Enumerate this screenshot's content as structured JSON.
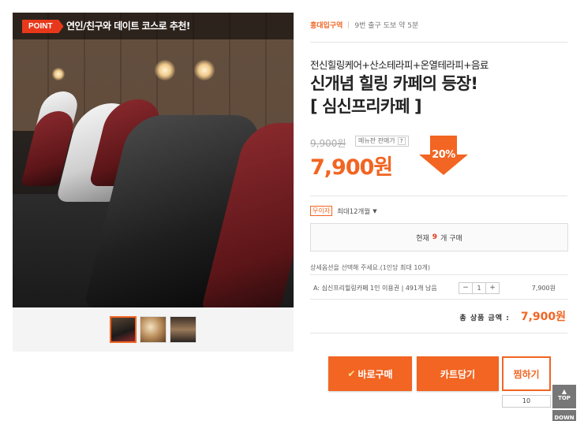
{
  "gallery": {
    "banner": {
      "badge": "POINT",
      "text": "연인/친구와 데이트 코스로 추천!"
    },
    "thumbnails": [
      "main-photo",
      "interior-photo",
      "cafe-photo"
    ]
  },
  "product": {
    "location_area": "홍대입구역",
    "location_detail": "9번 출구 도보 약 5분",
    "subtitle": "전신힐링케어+산소테라피+온열테라피+음료",
    "title_line1": "신개념 힐링 카페의 등장!",
    "title_line2": "[ 심신프리카페 ]",
    "original_price": "9,900원",
    "fixed_price_label": "메뉴판 판매가",
    "help": "?",
    "sale_price": "7,900원",
    "discount": "20%"
  },
  "installment": {
    "free_tag": "무이자",
    "label": "최대12개월",
    "caret": "▼"
  },
  "purchase_status": {
    "prefix": "현재",
    "count": "9",
    "suffix": "개 구매"
  },
  "options": {
    "guide": "상세옵션을 선택해 주세요.(1인당 최대 10개)",
    "rows": [
      {
        "name": "A: 심신프리힐링카페 1인 이용권  | 491개 남음",
        "qty": "1",
        "minus": "−",
        "plus": "+",
        "price": "7,900원"
      }
    ]
  },
  "total": {
    "label": "총 상품 금액 :",
    "value": "7,900원"
  },
  "actions": {
    "buy_label": "바로구매",
    "cart_label": "카트담기",
    "wish_label": "찜하기",
    "wish_count": "10"
  },
  "scroll": {
    "top_label": "TOP",
    "down_label": "DOWN"
  },
  "colors": {
    "accent": "#f26522",
    "badge": "#e8381b"
  }
}
